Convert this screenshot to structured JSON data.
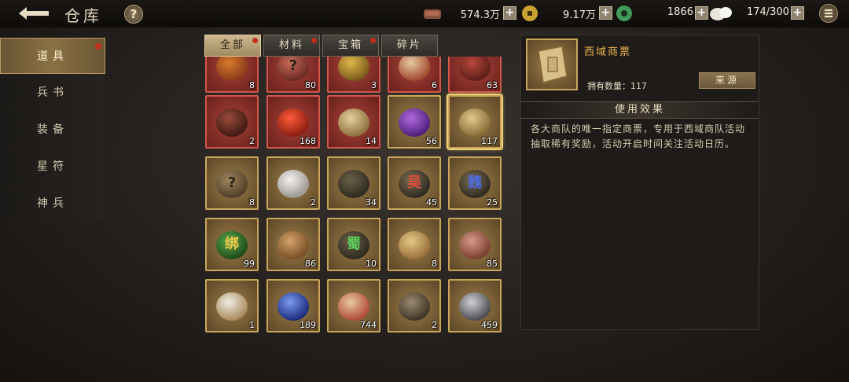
{
  "header": {
    "title": "仓库",
    "help_label": "?",
    "resources": [
      {
        "icon": "copper-coin-icon",
        "value": "574.3万"
      },
      {
        "icon": "gold-coin-icon",
        "value": "9.17万"
      },
      {
        "icon": "jade-icon",
        "value": "1866"
      },
      {
        "icon": "silk-icon",
        "value": "174/300"
      }
    ],
    "plus_label": "+"
  },
  "sidebar": {
    "items": [
      {
        "label": "道具",
        "active": true,
        "badge": true
      },
      {
        "label": "兵书",
        "active": false,
        "badge": false
      },
      {
        "label": "装备",
        "active": false,
        "badge": false
      },
      {
        "label": "星符",
        "active": false,
        "badge": false
      },
      {
        "label": "神兵",
        "active": false,
        "badge": false
      }
    ]
  },
  "tabs": [
    {
      "label": "全部",
      "active": true,
      "badge": true
    },
    {
      "label": "材料",
      "active": false,
      "badge": true
    },
    {
      "label": "宝箱",
      "active": false,
      "badge": true
    },
    {
      "label": "碎片",
      "active": false,
      "badge": false
    }
  ],
  "items": [
    {
      "icon": "gourd-icon",
      "count": "8",
      "quality": "red"
    },
    {
      "icon": "mystery-chest-icon",
      "count": "80",
      "quality": "red",
      "glyph": "?"
    },
    {
      "icon": "gold-ingot-icon",
      "count": "3",
      "quality": "red"
    },
    {
      "icon": "jewel-plate-icon",
      "count": "6",
      "quality": "red"
    },
    {
      "icon": "red-chest-icon",
      "count": "63",
      "quality": "red"
    },
    {
      "icon": "treasure-chest-icon",
      "count": "2",
      "quality": "red"
    },
    {
      "icon": "red-orb-icon",
      "count": "168",
      "quality": "red"
    },
    {
      "icon": "scroll-icon",
      "count": "14",
      "quality": "red"
    },
    {
      "icon": "purple-bean-icon",
      "count": "56",
      "quality": "gold"
    },
    {
      "icon": "merchant-ticket-icon",
      "count": "117",
      "quality": "gold",
      "selected": true
    },
    {
      "icon": "puzzle-piece-icon",
      "count": "8",
      "quality": "gold",
      "glyph": "?"
    },
    {
      "icon": "rabbit-icon",
      "count": "2",
      "quality": "gold"
    },
    {
      "icon": "token-piece-icon",
      "count": "34",
      "quality": "gold"
    },
    {
      "icon": "wu-piece-icon",
      "count": "45",
      "quality": "gold",
      "glyph": "吴"
    },
    {
      "icon": "wei-piece-icon",
      "count": "25",
      "quality": "gold",
      "glyph": "魏"
    },
    {
      "icon": "jade-bi-icon",
      "count": "99",
      "quality": "gold",
      "glyph": "绑"
    },
    {
      "icon": "mooncake-icon",
      "count": "86",
      "quality": "gold"
    },
    {
      "icon": "shu-piece-icon",
      "count": "10",
      "quality": "gold",
      "glyph": "蜀"
    },
    {
      "icon": "map-scroll-icon",
      "count": "8",
      "quality": "gold"
    },
    {
      "icon": "cake-icon",
      "count": "85",
      "quality": "gold"
    },
    {
      "icon": "steamed-bun-icon",
      "count": "1",
      "quality": "gold"
    },
    {
      "icon": "blue-orb-icon",
      "count": "189",
      "quality": "gold"
    },
    {
      "icon": "gift-book-icon",
      "count": "744",
      "quality": "gold"
    },
    {
      "icon": "hammer-icon",
      "count": "2",
      "quality": "gold"
    },
    {
      "icon": "iron-ingot-icon",
      "count": "459",
      "quality": "gold"
    }
  ],
  "detail": {
    "name": "西域商票",
    "qty_label": "拥有数量：117",
    "source_label": "来源",
    "effect_header": "使用效果",
    "effect_text": "各大商队的唯一指定商票，专用于西域商队活动抽取稀有奖励，活动开启时间关注活动日历。"
  },
  "colors": {
    "accent_gold": "#e8b24c",
    "badge_red": "#c22d1e",
    "quality_red": "#a8443a",
    "quality_gold": "#9c7e4a"
  }
}
